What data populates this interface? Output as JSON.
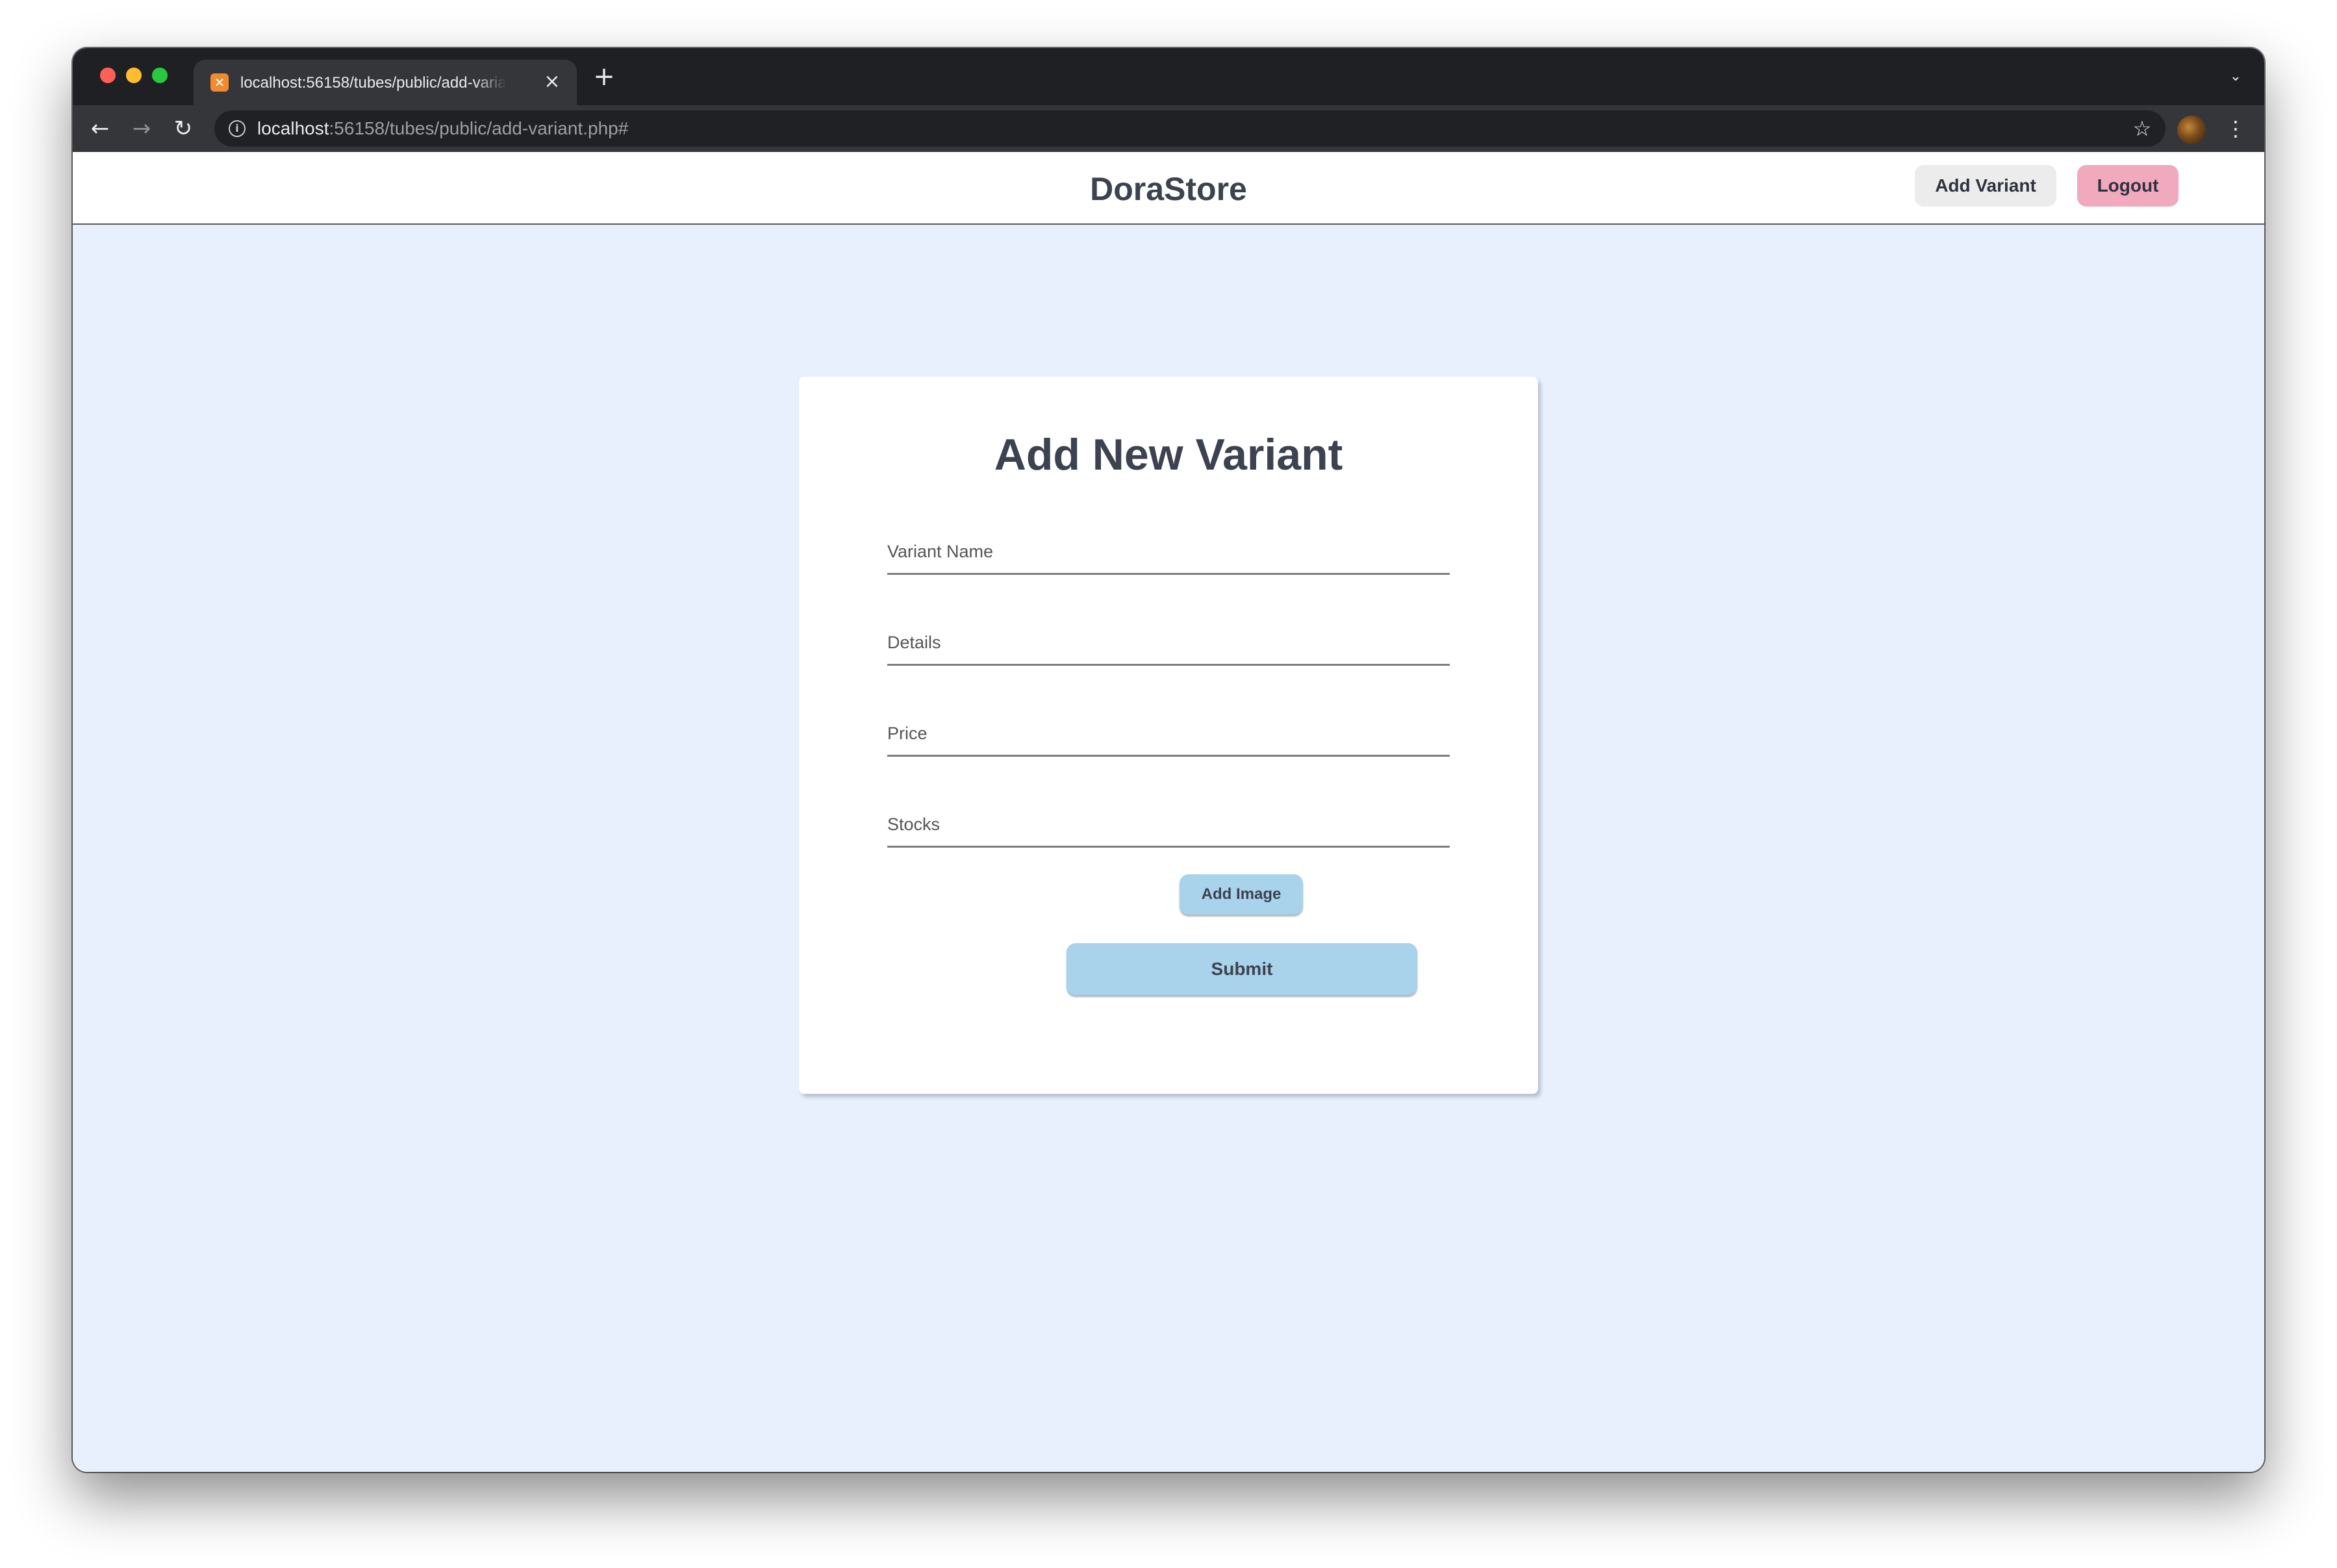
{
  "browser": {
    "tab": {
      "title": "localhost:56158/tubes/public/add-variant.php#",
      "favicon_icon": "xampp-icon"
    },
    "address_bar": {
      "host": "localhost",
      "path": ":56158/tubes/public/add-variant.php#"
    },
    "icons": {
      "close": "×",
      "new_tab": "+",
      "tab_search": "⌄",
      "back": "←",
      "forward": "→",
      "reload": "↻",
      "info": "i",
      "star": "☆",
      "menu": "⋮"
    }
  },
  "header": {
    "brand": "DoraStore",
    "add_variant_label": "Add Variant",
    "logout_label": "Logout"
  },
  "form": {
    "title": "Add New Variant",
    "fields": [
      {
        "placeholder": "Variant Name",
        "value": ""
      },
      {
        "placeholder": "Details",
        "value": ""
      },
      {
        "placeholder": "Price",
        "value": ""
      },
      {
        "placeholder": "Stocks",
        "value": ""
      }
    ],
    "add_image_label": "Add Image",
    "submit_label": "Submit"
  },
  "colors": {
    "page_background": "#e8f0fd",
    "primary_button": "#a9d3eb",
    "logout_button": "#f0a9bd",
    "secondary_button": "#ececec",
    "heading_text": "#3d4250"
  }
}
